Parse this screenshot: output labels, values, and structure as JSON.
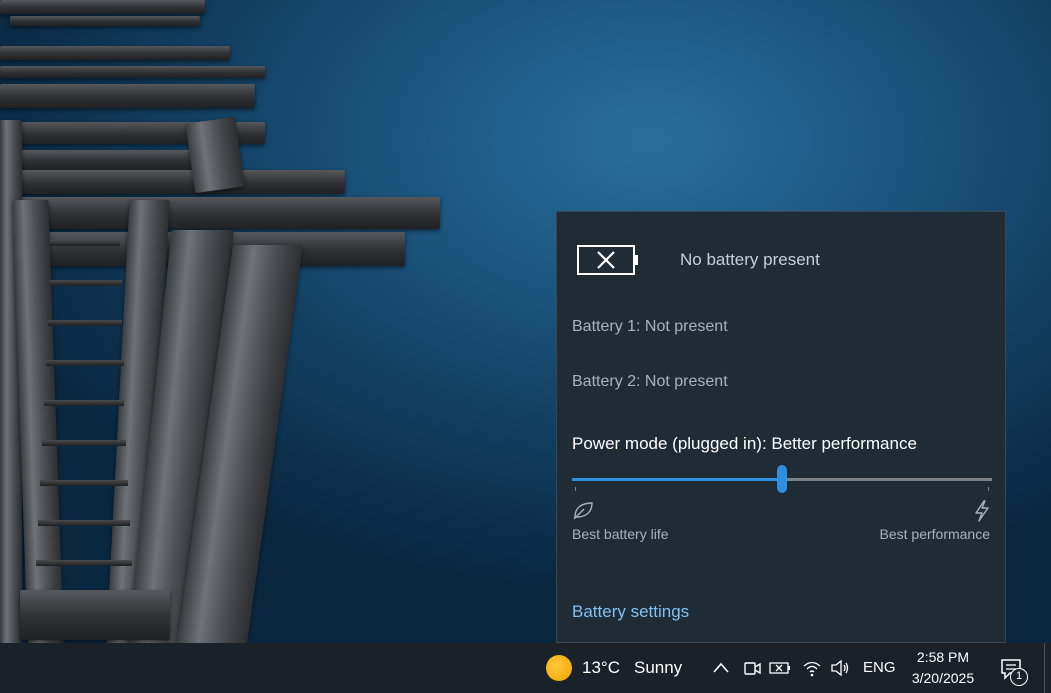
{
  "battery_flyout": {
    "status": "No battery present",
    "battery1": "Battery 1: Not present",
    "battery2": "Battery 2: Not present",
    "power_mode": "Power mode (plugged in): Better performance",
    "power_slider_level": 0.5,
    "label_left": "Best battery life",
    "label_right": "Best performance",
    "settings_link": "Battery settings",
    "accent_color": "#2f8ee0",
    "link_color": "#7fc1f5"
  },
  "taskbar": {
    "weather": {
      "temperature": "13°C",
      "condition": "Sunny",
      "icon": "sun-icon"
    },
    "tray_icons": [
      "chevron-up-icon",
      "meet-now-icon",
      "battery-x-icon",
      "wifi-icon",
      "volume-icon"
    ],
    "language": "ENG",
    "time": "2:58 PM",
    "date": "3/20/2025",
    "notification_count": "1"
  }
}
